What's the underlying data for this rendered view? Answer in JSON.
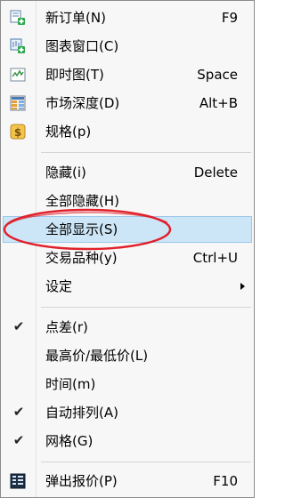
{
  "menu": {
    "items": [
      {
        "label": "新订单(N)",
        "shortcut": "F9",
        "icon": "new-order-icon"
      },
      {
        "label": "图表窗口(C)",
        "shortcut": "",
        "icon": "chart-window-icon"
      },
      {
        "label": "即时图(T)",
        "shortcut": "Space",
        "icon": "tick-chart-icon"
      },
      {
        "label": "市场深度(D)",
        "shortcut": "Alt+B",
        "icon": "market-depth-icon"
      },
      {
        "label": "规格(p)",
        "shortcut": "",
        "icon": "specification-icon"
      },
      {
        "label": "隐藏(i)",
        "shortcut": "Delete"
      },
      {
        "label": "全部隐藏(H)",
        "shortcut": ""
      },
      {
        "label": "全部显示(S)",
        "shortcut": "",
        "highlighted": true
      },
      {
        "label": "交易品种(y)",
        "shortcut": "Ctrl+U"
      },
      {
        "label": "设定",
        "shortcut": "",
        "submenu": true
      },
      {
        "label": "点差(r)",
        "shortcut": "",
        "checked": true
      },
      {
        "label": "最高价/最低价(L)",
        "shortcut": "",
        "checked": false
      },
      {
        "label": "时间(m)",
        "shortcut": "",
        "checked": false
      },
      {
        "label": "自动排列(A)",
        "shortcut": "",
        "checked": true
      },
      {
        "label": "网格(G)",
        "shortcut": "",
        "checked": true
      },
      {
        "label": "弹出报价(P)",
        "shortcut": "F10",
        "icon": "popup-prices-icon"
      }
    ]
  },
  "colors": {
    "highlight_fill": "#cde6f7",
    "highlight_border": "#99c8ea",
    "annotation": "#e0202a"
  }
}
